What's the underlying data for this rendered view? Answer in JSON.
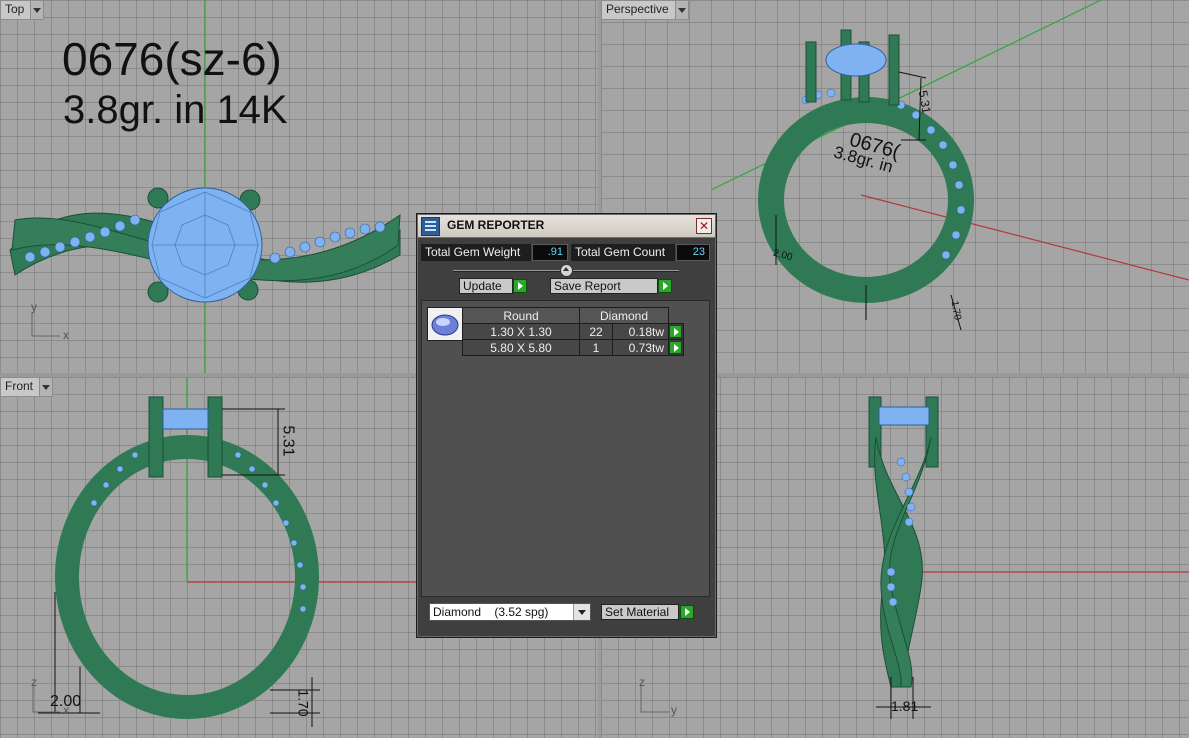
{
  "viewports": {
    "top": {
      "label": "Top",
      "note_line1": "0676(sz-6)",
      "note_line2": "3.8gr.  in 14K",
      "axis_x": "x",
      "axis_y": "y"
    },
    "perspective": {
      "label": "Perspective",
      "note_line1": "0676(",
      "note_line2": "3.8gr.  in",
      "dim_height": "5.31",
      "dim_width": "2.00",
      "dim_thick": "1.70"
    },
    "front": {
      "label": "Front",
      "dim_height": "5.31",
      "dim_width": "2.00",
      "dim_thick": "1.70",
      "axis_x": "x",
      "axis_z": "z"
    },
    "right": {
      "dim_width": "1.81",
      "axis_y": "y",
      "axis_z": "z"
    }
  },
  "gem_reporter": {
    "title": "GEM REPORTER",
    "close_label": "✕",
    "total_weight_label": "Total Gem Weight",
    "total_weight_value": ".91",
    "total_count_label": "Total Gem Count",
    "total_count_value": "23",
    "update_label": "Update",
    "save_report_label": "Save Report",
    "table_headers": {
      "shape": "Round",
      "material": "Diamond"
    },
    "rows": [
      {
        "size": "1.30 X 1.30",
        "count": "22",
        "carat": "0.18tw"
      },
      {
        "size": "5.80 X 5.80",
        "count": "1",
        "carat": "0.73tw"
      }
    ],
    "material_select": "Diamond    (3.52 spg)",
    "set_material_label": "Set Material"
  },
  "colors": {
    "metal": "#2f7a55",
    "gem": "#7fb2f0",
    "grid_bg": "#a5a5a5",
    "axis_red": "#b23a3a",
    "axis_green": "#2fa83a"
  }
}
